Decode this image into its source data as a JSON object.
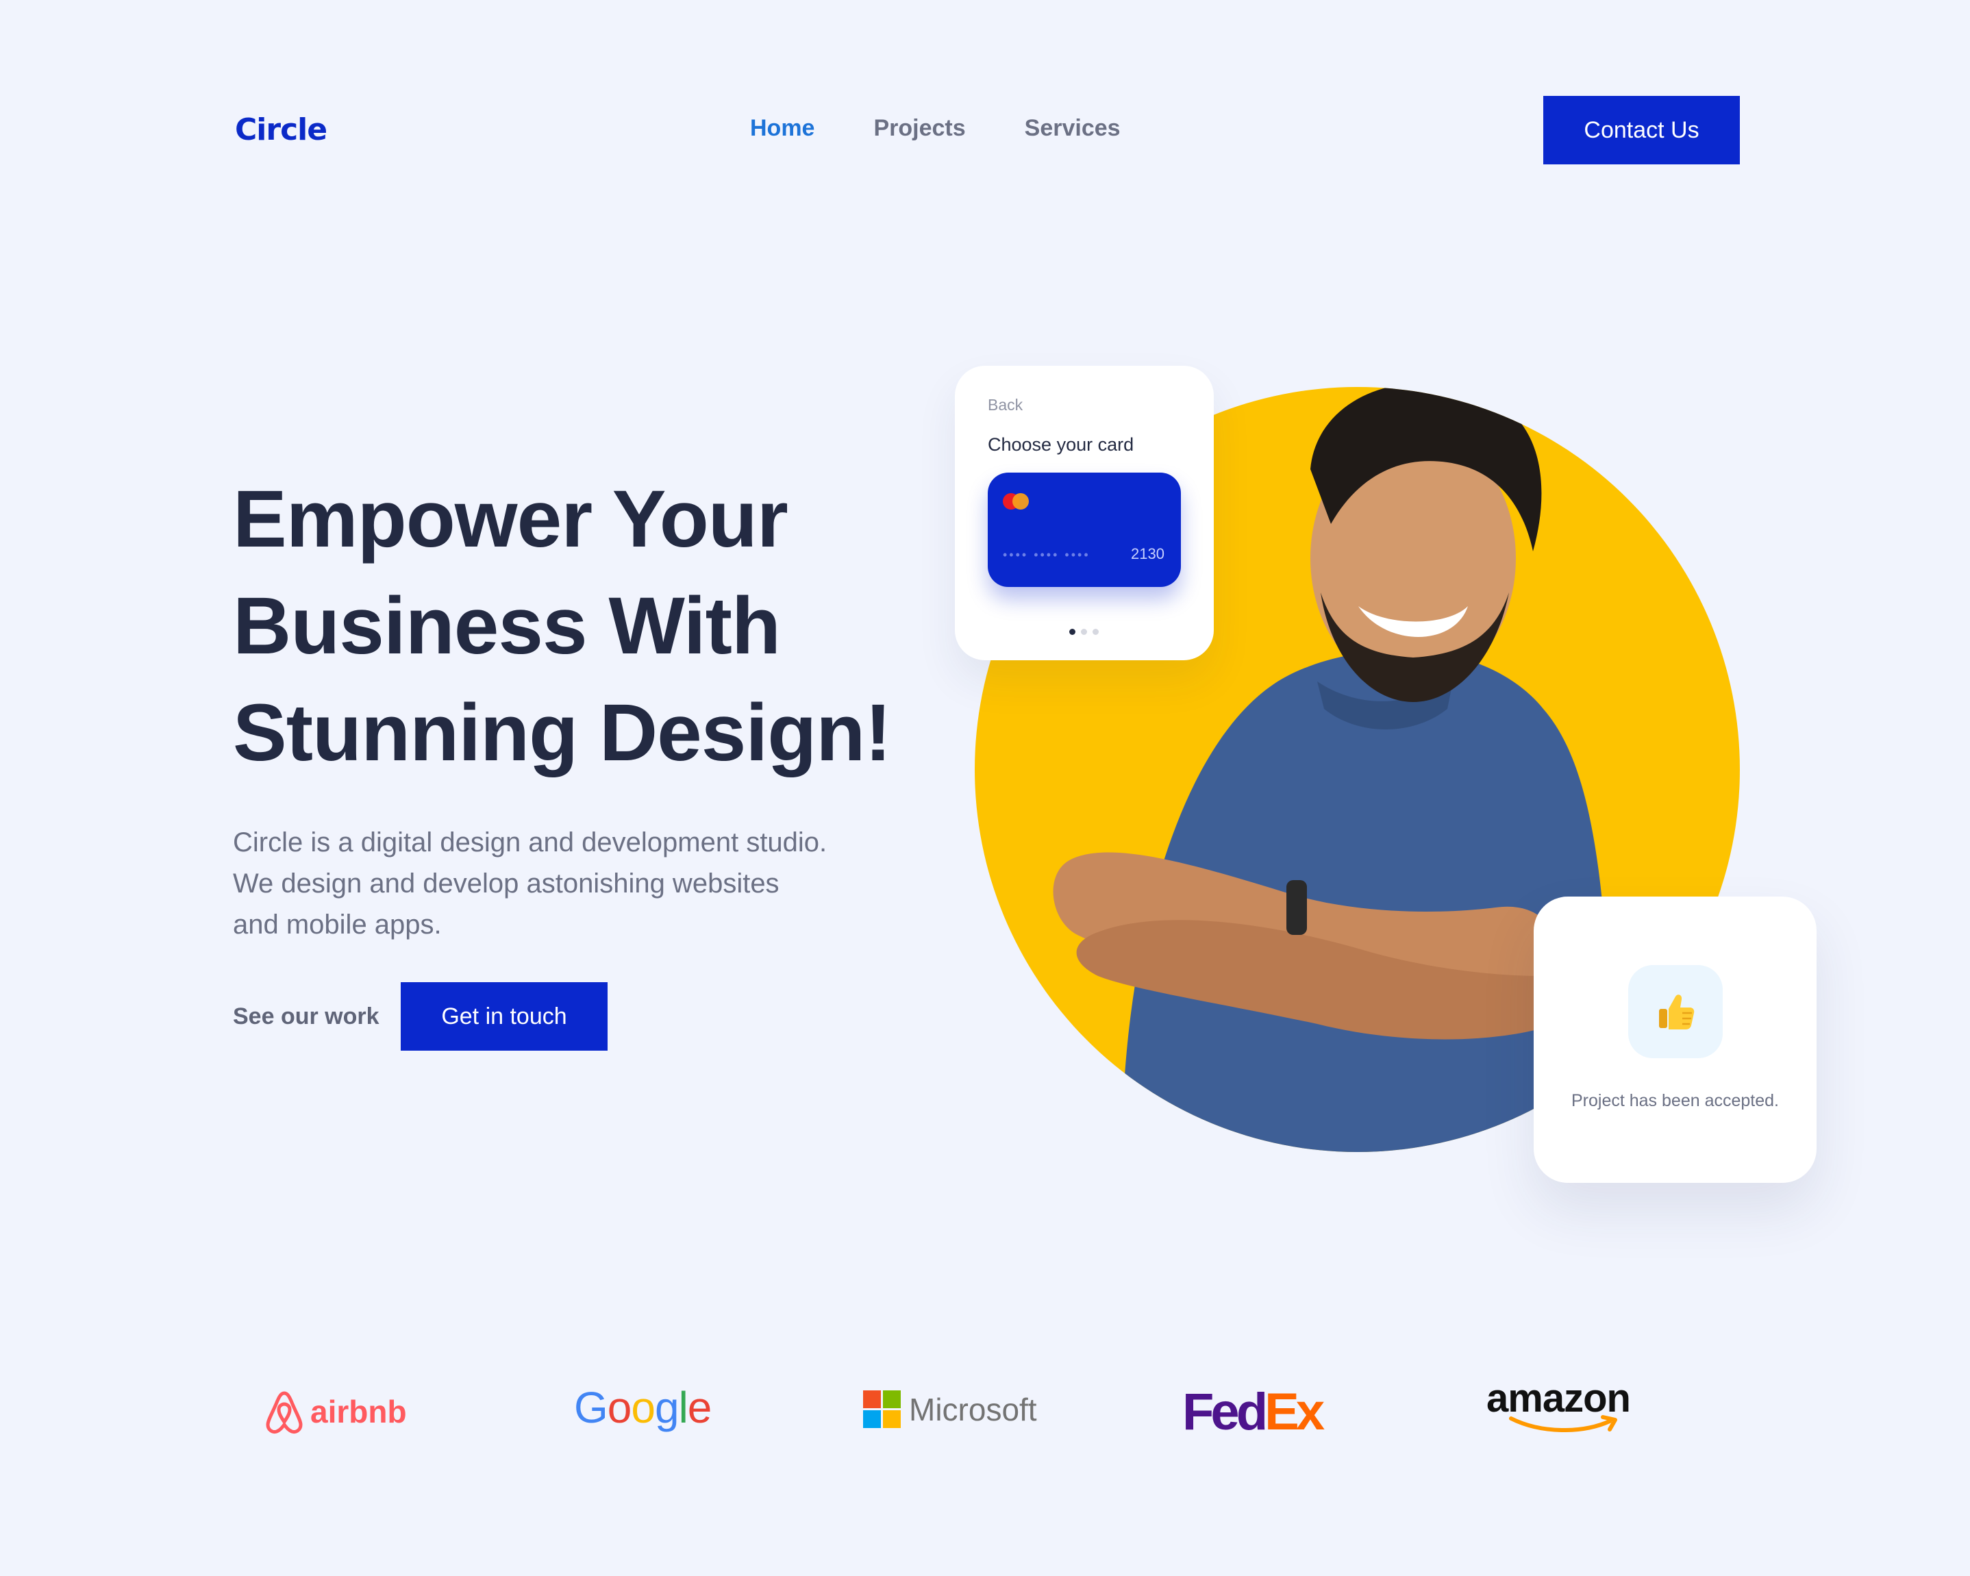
{
  "brand": {
    "name": "Circle"
  },
  "nav": {
    "items": [
      {
        "label": "Home",
        "active": true
      },
      {
        "label": "Projects",
        "active": false
      },
      {
        "label": "Services",
        "active": false
      }
    ],
    "contact_label": "Contact Us"
  },
  "hero": {
    "title_lines": [
      "Empower Your",
      "Business With",
      "Stunning Design!"
    ],
    "description_lines": [
      "Circle is a digital design and development studio.",
      "We design and develop astonishing websites",
      "and mobile apps."
    ],
    "see_work_label": "See our work",
    "get_in_touch_label": "Get in touch"
  },
  "card_widget": {
    "back_label": "Back",
    "title": "Choose your card",
    "masked_digits": "•••• •••• ••••",
    "last_digits": "2130",
    "card_icon": "mastercard-icon",
    "pager_active_index": 0,
    "pager_total": 3
  },
  "accepted_widget": {
    "icon": "thumbs-up-icon",
    "text": "Project has been accepted."
  },
  "partners": {
    "airbnb": "airbnb",
    "google_letters": [
      "G",
      "o",
      "o",
      "g",
      "l",
      "e"
    ],
    "microsoft": "Microsoft",
    "fedex_fed": "Fed",
    "fedex_ex": "Ex",
    "amazon": "amazon"
  },
  "colors": {
    "background": "#F1F4FD",
    "primary": "#0A28CD",
    "nav_active": "#1D73D8",
    "heading": "#232A42",
    "body_text": "#6B7084",
    "accent_yellow": "#FDC300"
  }
}
